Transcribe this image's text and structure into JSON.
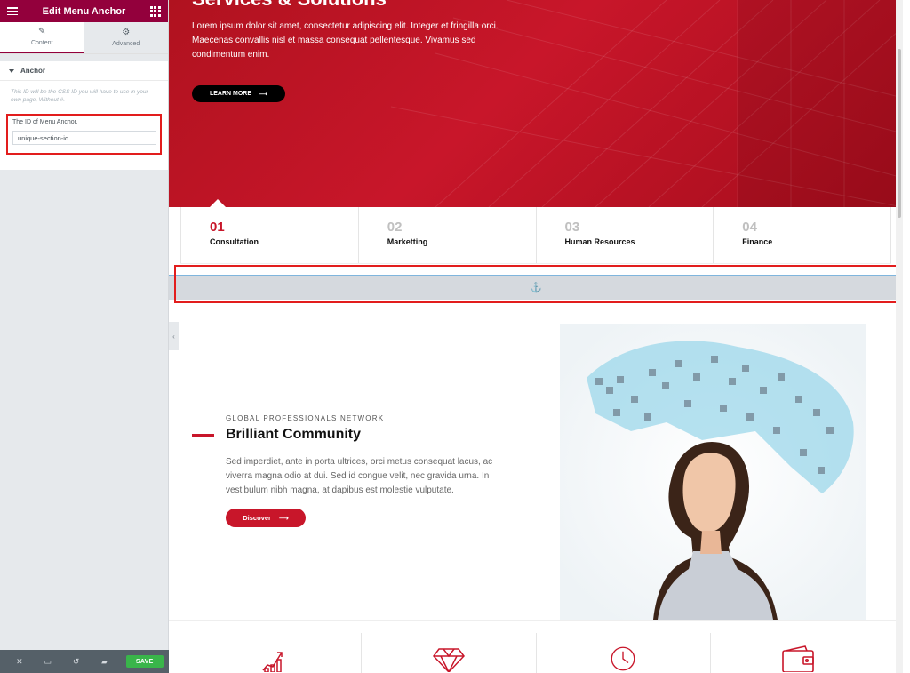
{
  "sidebar": {
    "title": "Edit Menu Anchor",
    "tabs": [
      {
        "label": "Content",
        "icon": "pencil-icon",
        "active": true
      },
      {
        "label": "Advanced",
        "icon": "gear-icon",
        "active": false
      }
    ],
    "section_title": "Anchor",
    "description": "This ID will be the CSS ID you will have to use in your own page, Without #.",
    "field_label": "The ID of Menu Anchor.",
    "field_value": "unique-section-id",
    "footer": {
      "save_label": "SAVE",
      "icons": [
        "close-icon",
        "desktop-icon",
        "history-icon",
        "folder-icon"
      ]
    }
  },
  "hero": {
    "title": "Services & Solutions",
    "text": "Lorem ipsum dolor sit amet, consectetur adipiscing elit. Integer et fringilla orci. Maecenas convallis nisl et massa consequat pellentesque. Vivamus sed condimentum enim.",
    "button_label": "LEARN MORE"
  },
  "service_tabs": [
    {
      "num": "01",
      "label": "Consultation",
      "active": true
    },
    {
      "num": "02",
      "label": "Marketting",
      "active": false
    },
    {
      "num": "03",
      "label": "Human Resources",
      "active": false
    },
    {
      "num": "04",
      "label": "Finance",
      "active": false
    }
  ],
  "about": {
    "eyebrow": "GLOBAL PROFESSIONALS NETWORK",
    "title": "Brilliant Community",
    "text": "Sed imperdiet, ante in porta ultrices, orci metus consequat lacus, ac viverra magna odio at dui. Sed id congue velit, nec gravida urna. In vestibulum nibh magna, at dapibus est molestie vulputate.",
    "button_label": "Discover"
  },
  "features": [
    "growth-chart-icon",
    "diamond-icon",
    "clock-icon",
    "wallet-icon"
  ],
  "colors": {
    "brand": "#93003c",
    "accent": "#c8162a",
    "save": "#39b54a",
    "highlight": "#e21d1d"
  }
}
